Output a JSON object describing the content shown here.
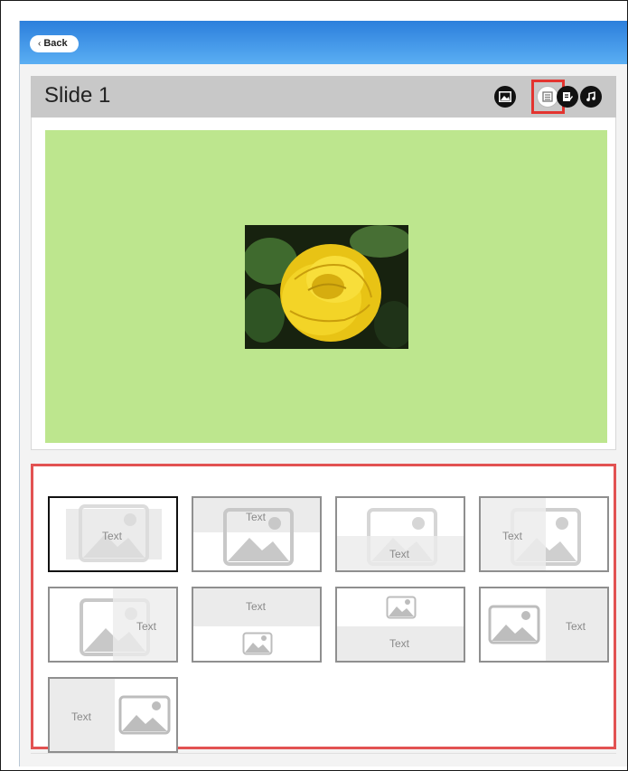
{
  "topbar": {
    "back_label": "Back"
  },
  "slide": {
    "title": "Slide 1",
    "header_icons": [
      "image-icon",
      "layout-icon",
      "text-edit-icon",
      "music-icon"
    ],
    "active_icon": "layout-icon",
    "canvas_color": "#bde68e"
  },
  "layouts": {
    "tiles": [
      {
        "text": "Text"
      },
      {
        "text": "Text"
      },
      {
        "text": "Text"
      },
      {
        "text": "Text"
      },
      {
        "text": "Text"
      },
      {
        "text": "Text"
      },
      {
        "text": "Text"
      },
      {
        "text": "Text"
      },
      {
        "text": "Text"
      }
    ],
    "selected_index": 0
  },
  "colors": {
    "topbar": "#3a8ee6",
    "highlight": "#e3342f",
    "header": "#c8c8c8"
  }
}
